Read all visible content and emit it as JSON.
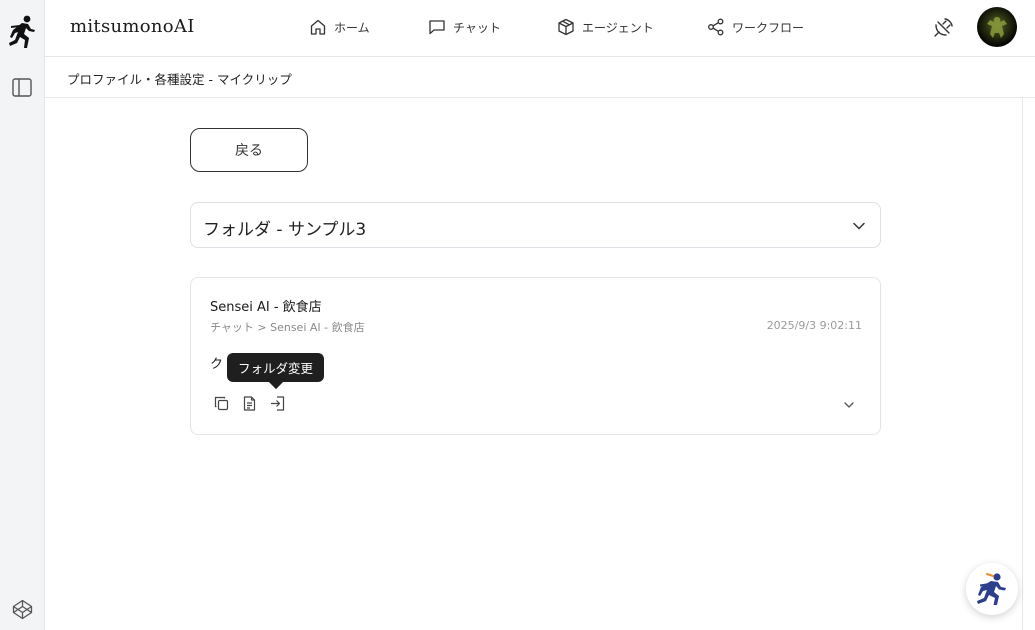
{
  "header": {
    "brand": "mitsumonoAI",
    "nav": [
      {
        "label": "ホーム",
        "icon": "home-icon"
      },
      {
        "label": "チャット",
        "icon": "chat-icon"
      },
      {
        "label": "エージェント",
        "icon": "cube-icon"
      },
      {
        "label": "ワークフロー",
        "icon": "share-icon"
      }
    ]
  },
  "breadcrumb": "プロファイル・各種設定 - マイクリップ",
  "back_button": "戻る",
  "folder_select": {
    "value": "フォルダ - サンプル3"
  },
  "clip": {
    "title": "Sensei AI - 飲食店",
    "path": "チャット > Sensei AI - 飲食店",
    "date": "2025/9/3 9:02:11",
    "body": "ク"
  },
  "tooltip": "フォルダ変更",
  "colors": {
    "sidebar_bg": "#f3f4f6",
    "border": "#e5e7eb",
    "tooltip_bg": "#1f1f1f",
    "logo_blue": "#2c3e8c",
    "logo_orange": "#f08a24"
  }
}
